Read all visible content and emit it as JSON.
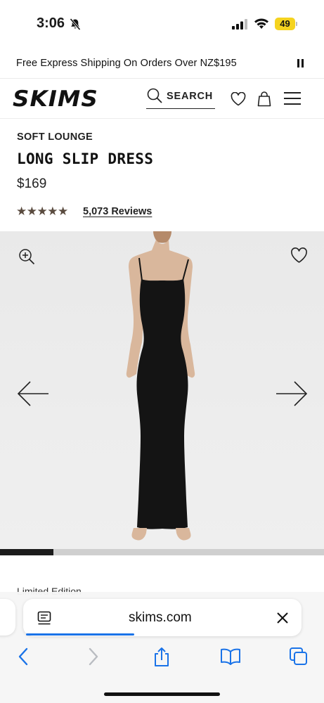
{
  "status_bar": {
    "time": "3:06",
    "battery": "49",
    "icons": [
      "bell-slash-icon",
      "cellular-signal-icon",
      "wifi-icon",
      "battery-icon"
    ]
  },
  "promo": {
    "text": "Free Express Shipping On Orders Over NZ$195",
    "control_icon": "pause-icon"
  },
  "header": {
    "logo": "SKIMS",
    "search_label": "SEARCH",
    "icons": [
      "search-icon",
      "heart-icon",
      "bag-icon",
      "menu-icon"
    ]
  },
  "product": {
    "collection": "SOFT LOUNGE",
    "name": "LONG SLIP DRESS",
    "price": "$169",
    "rating": 4.5,
    "stars": "★★★★★",
    "reviews": "5,073 Reviews"
  },
  "gallery": {
    "icons": [
      "zoom-in-icon",
      "heart-icon",
      "arrow-left-icon",
      "arrow-right-icon"
    ],
    "progress": 0.165
  },
  "below_fold": {
    "label": "Limited Edition"
  },
  "browser": {
    "url": "skims.com",
    "load_progress": 0.39,
    "accent": "#1a73e8",
    "toolbar_icons": [
      "back-icon",
      "forward-icon",
      "share-icon",
      "bookmarks-icon",
      "tabs-icon"
    ]
  },
  "colors": {
    "star": "#5a4b3f",
    "battery": "#f5d31f",
    "ios_blue": "#1a73e8"
  }
}
